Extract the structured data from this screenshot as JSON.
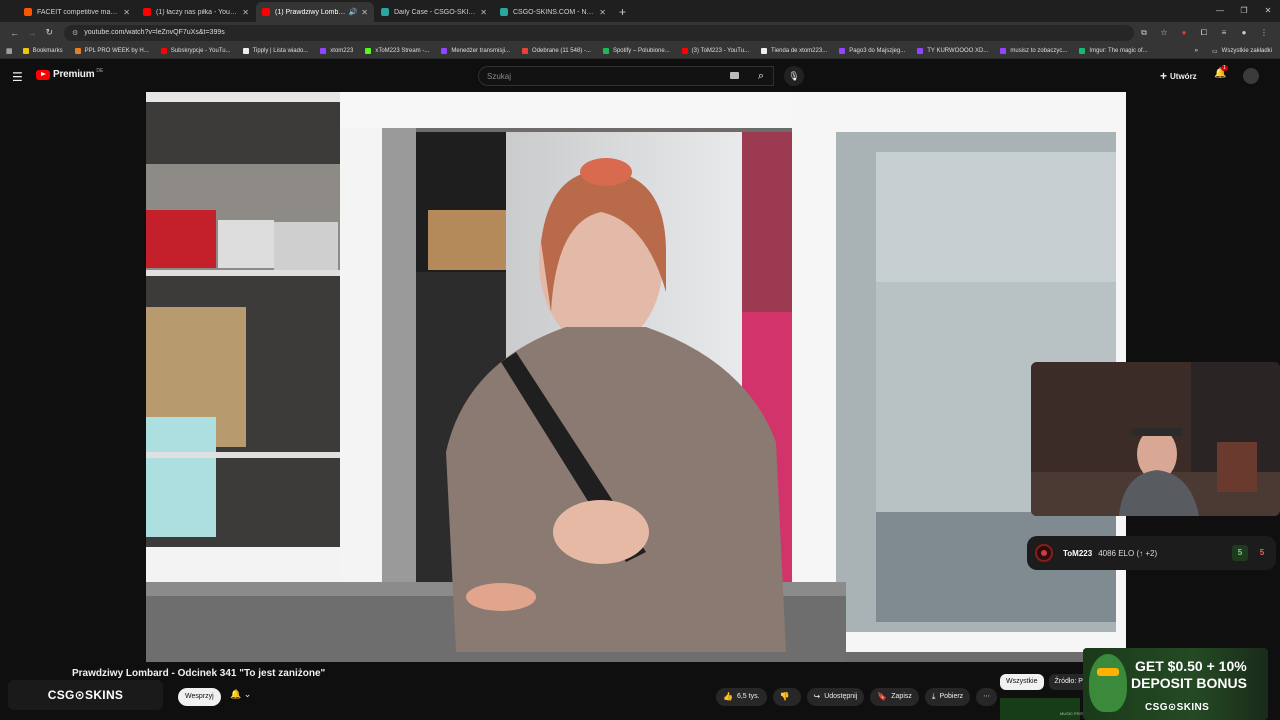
{
  "browser": {
    "tabs": [
      {
        "title": "FACEIT competitive match - FA...",
        "color": "#ff5500",
        "active": false,
        "audio": false
      },
      {
        "title": "(1) łaczy nas piłka - YouTube",
        "color": "#ff0000",
        "active": false,
        "audio": false
      },
      {
        "title": "(1) Prawdziwy Lombard - O...",
        "color": "#ff0000",
        "active": true,
        "audio": true
      },
      {
        "title": "Daily Case - CSGO-SKINS.COM",
        "color": "#2aa5a0",
        "active": false,
        "audio": false
      },
      {
        "title": "CSGO-SKINS.COM - Najlepsze...",
        "color": "#2aa5a0",
        "active": false,
        "audio": false
      }
    ],
    "url": "youtube.com/watch?v=leZnvQF7uXs&t=399s",
    "bookmarks": [
      {
        "label": "Bookmarks",
        "color": "#f1c40f"
      },
      {
        "label": "PPL PRO WEEK by H...",
        "color": "#e67e22"
      },
      {
        "label": "Subskrypcje - YouTu...",
        "color": "#ff0000"
      },
      {
        "label": "Tipply | Lista wiado...",
        "color": "#eeeeee"
      },
      {
        "label": "xtom223",
        "color": "#9146ff"
      },
      {
        "label": "xToM223 Stream -...",
        "color": "#53fc18"
      },
      {
        "label": "Menedżer transmisji...",
        "color": "#9146ff"
      },
      {
        "label": "Odebrane (11 548) -...",
        "color": "#ea4335"
      },
      {
        "label": "Spotify – Polubione...",
        "color": "#1db954"
      },
      {
        "label": "(3) ToM223 - YouTu...",
        "color": "#ff0000"
      },
      {
        "label": "Tienda de xtom223...",
        "color": "#eeeeee"
      },
      {
        "label": "Pago3 do Majszjeg...",
        "color": "#9146ff"
      },
      {
        "label": "TY KURWOOOO XD...",
        "color": "#9146ff"
      },
      {
        "label": "musisz to zobaczyc...",
        "color": "#9146ff"
      },
      {
        "label": "Imgur: The magic of...",
        "color": "#1bb76e"
      }
    ],
    "all_bookmarks": "Wszystkie zakładki"
  },
  "youtube": {
    "brand": "Premium",
    "region": "DE",
    "search_placeholder": "Szukaj",
    "create_label": "Utwórz",
    "notif_count": "1"
  },
  "overlay": {
    "player": "ToM223",
    "elo": "4086 ELO (↑ +2)",
    "wins": "5",
    "losses": "5"
  },
  "video": {
    "title": "Prawdziwy Lombard - Odcinek 341 \"To jest zaniżone\"",
    "channel": "CSG⊙SKINS",
    "support_label": "Wesprzyj",
    "likes": "6,5 tys.",
    "share_label": "Udostępnij",
    "save_label": "Zapisz",
    "download_label": "Pobierz"
  },
  "recommendations": {
    "chips": [
      "Wszystkie",
      "Źródło: P"
    ],
    "thumb_caption": "MUSIC FESTIVAL MIAMI 2026"
  },
  "ad": {
    "line1": "GET $0.50 + 10%",
    "line2": "DEPOSIT BONUS",
    "brand": "CSG⊙SKINS"
  }
}
